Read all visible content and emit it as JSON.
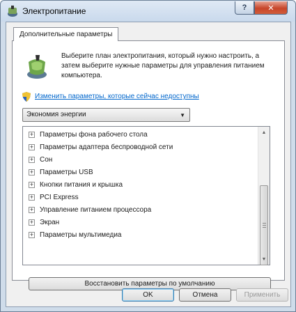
{
  "window": {
    "title": "Электропитание",
    "help_label": "?",
    "close_label": "✕"
  },
  "tab": {
    "label": "Дополнительные параметры"
  },
  "description": "Выберите план электропитания, который нужно настроить, а затем выберите нужные параметры для управления питанием компьютера.",
  "change_link": "Изменить параметры, которые сейчас недоступны",
  "plan_select": {
    "value": "Экономия энергии"
  },
  "settings_tree": {
    "items": [
      "Параметры фона рабочего стола",
      "Параметры адаптера беспроводной сети",
      "Сон",
      "Параметры USB",
      "Кнопки питания и крышка",
      "PCI Express",
      "Управление питанием процессора",
      "Экран",
      "Параметры мультимедиа"
    ],
    "expand_symbol": "+"
  },
  "restore_button": "Восстановить параметры по умолчанию",
  "footer": {
    "ok": "OK",
    "cancel": "Отмена",
    "apply": "Применить"
  }
}
